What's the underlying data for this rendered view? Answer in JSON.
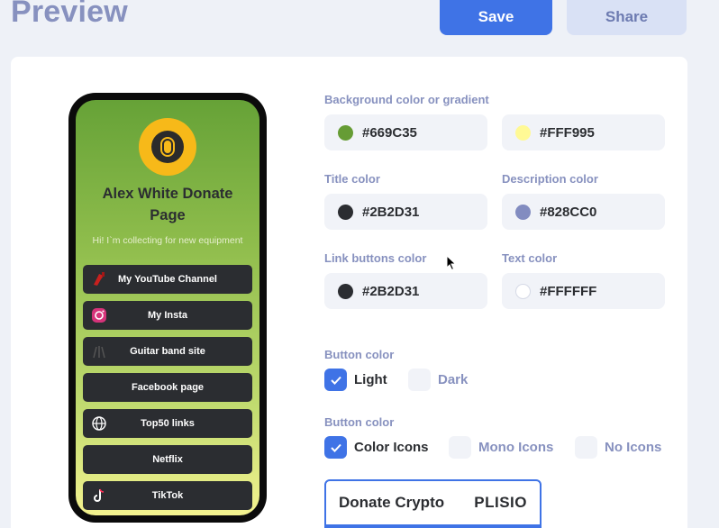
{
  "header": {
    "title": "Preview",
    "save_label": "Save",
    "share_label": "Share"
  },
  "phone": {
    "title": "Alex White Donate Page",
    "description": "Hi! I`m collecting for new equipment",
    "links": [
      {
        "label": "My YouTube Channel",
        "icon": "guitar-icon"
      },
      {
        "label": "My Insta",
        "icon": "instagram-icon"
      },
      {
        "label": "Guitar band site",
        "icon": "band-icon"
      },
      {
        "label": "Facebook page",
        "icon": ""
      },
      {
        "label": "Top50 links",
        "icon": "globe-icon"
      },
      {
        "label": "Netflix",
        "icon": ""
      },
      {
        "label": "TikTok",
        "icon": "tiktok-icon"
      }
    ]
  },
  "settings": {
    "background": {
      "label": "Background color or gradient",
      "color1": "#669C35",
      "color2": "#FFF995"
    },
    "title_color": {
      "label": "Title color",
      "value": "#2B2D31"
    },
    "description_color": {
      "label": "Description color",
      "value": "#828CC0"
    },
    "link_buttons_color": {
      "label": "Link buttons color",
      "value": "#2B2D31"
    },
    "text_color": {
      "label": "Text color",
      "value": "#FFFFFF"
    },
    "button_color": {
      "label": "Button color",
      "options": [
        "Light",
        "Dark"
      ],
      "selected": "Light"
    },
    "button_icons": {
      "label": "Button color",
      "options": [
        "Color Icons",
        "Mono Icons",
        "No Icons"
      ],
      "selected": "Color Icons"
    }
  },
  "crypto": {
    "title": "Donate Crypto",
    "brand": "PLISIO"
  },
  "colors": {
    "accent": "#3F73E6",
    "muted": "#8791BF",
    "dark": "#2B2D31"
  }
}
